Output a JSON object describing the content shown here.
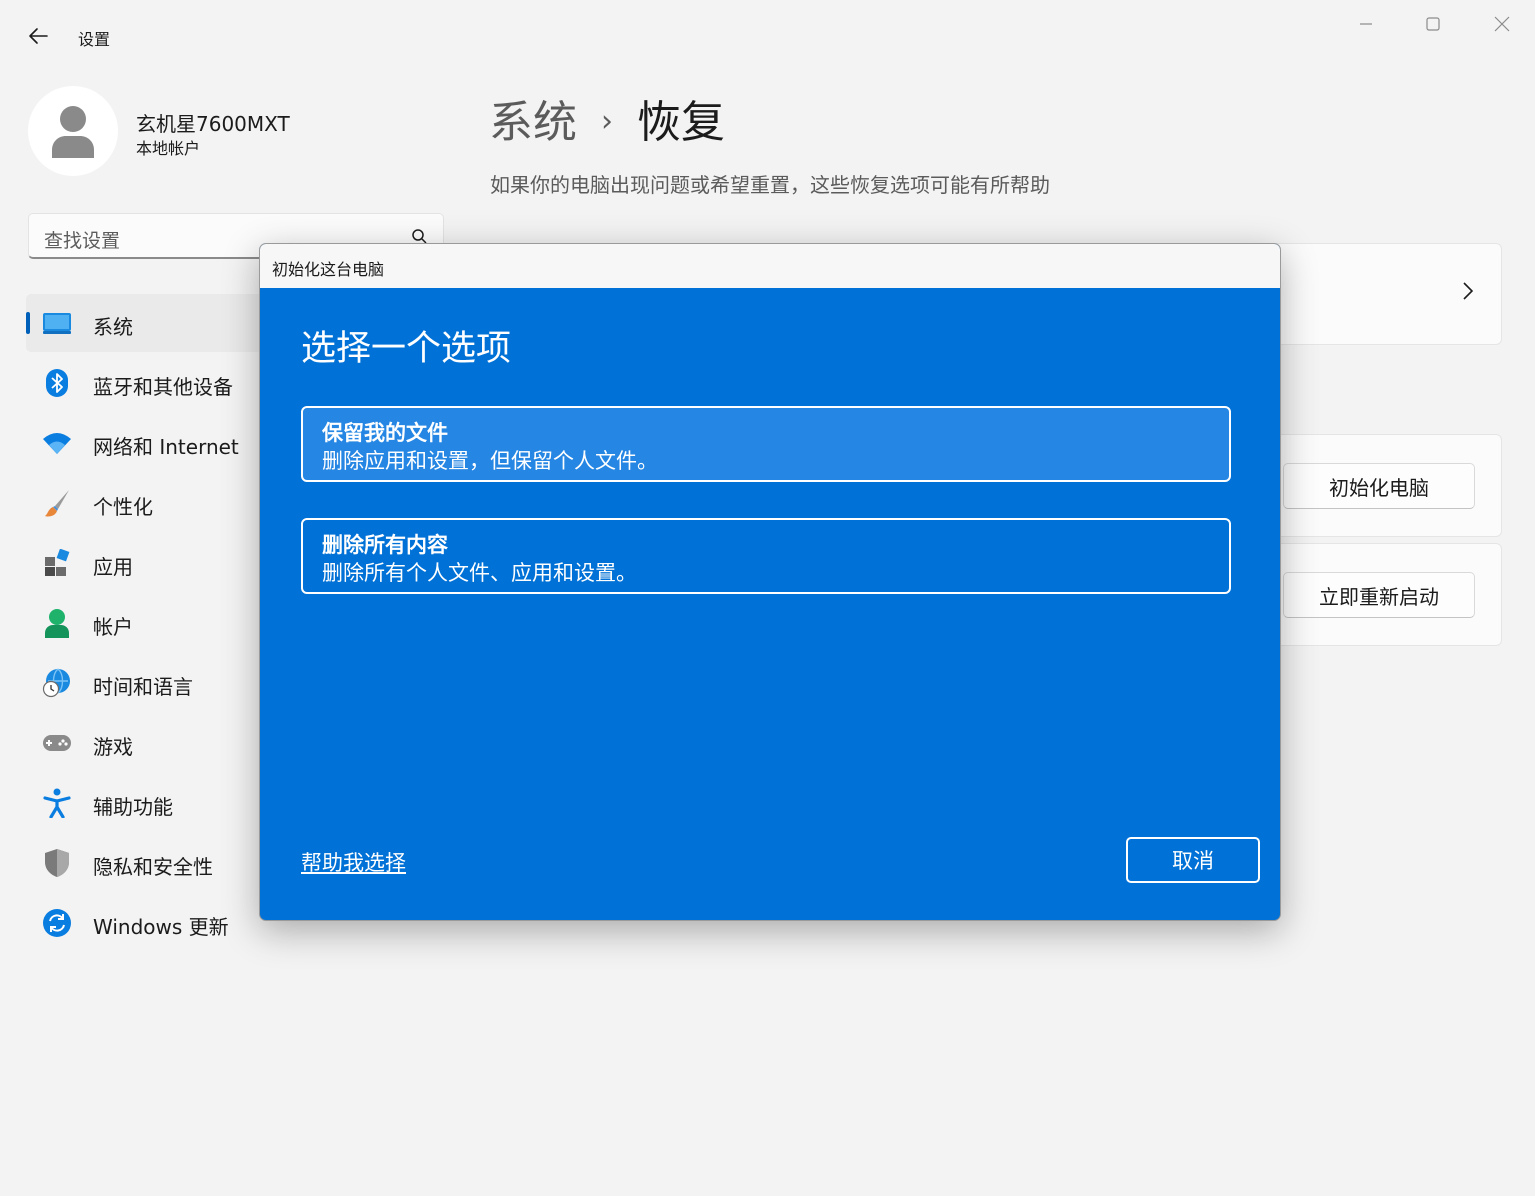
{
  "window": {
    "app_title": "设置",
    "back_icon": "back-arrow-icon",
    "controls": [
      "minimize-icon",
      "maximize-icon",
      "close-icon"
    ]
  },
  "profile": {
    "name": "玄机星7600MXT",
    "account_type": "本地帐户"
  },
  "search": {
    "placeholder": "查找设置"
  },
  "sidebar": {
    "items": [
      {
        "label": "系统",
        "icon": "system-display-icon",
        "active": true
      },
      {
        "label": "蓝牙和其他设备",
        "icon": "bluetooth-icon"
      },
      {
        "label": "网络和 Internet",
        "icon": "wifi-icon"
      },
      {
        "label": "个性化",
        "icon": "paintbrush-icon"
      },
      {
        "label": "应用",
        "icon": "apps-icon"
      },
      {
        "label": "帐户",
        "icon": "account-icon"
      },
      {
        "label": "时间和语言",
        "icon": "time-language-icon"
      },
      {
        "label": "游戏",
        "icon": "gamepad-icon"
      },
      {
        "label": "辅助功能",
        "icon": "accessibility-icon"
      },
      {
        "label": "隐私和安全性",
        "icon": "shield-icon"
      },
      {
        "label": "Windows 更新",
        "icon": "windows-update-icon"
      }
    ]
  },
  "header": {
    "breadcrumb_parent": "系统",
    "breadcrumb_separator": "›",
    "breadcrumb_current": "恢复",
    "subtitle": "如果你的电脑出现问题或希望重置，这些恢复选项可能有所帮助"
  },
  "cards": {
    "reset_button": "初始化电脑",
    "restart_button": "立即重新启动"
  },
  "dialog": {
    "title": "初始化这台电脑",
    "heading": "选择一个选项",
    "options": [
      {
        "title": "保留我的文件",
        "description": "删除应用和设置，但保留个人文件。",
        "selected": true
      },
      {
        "title": "删除所有内容",
        "description": "删除所有个人文件、应用和设置。",
        "selected": false
      }
    ],
    "help_link": "帮助我选择",
    "cancel_button": "取消"
  },
  "colors": {
    "accent": "#005fb8",
    "dialog_background": "#0071d6",
    "selected_option": "#2586e3",
    "window_background": "#f3f3f3"
  }
}
